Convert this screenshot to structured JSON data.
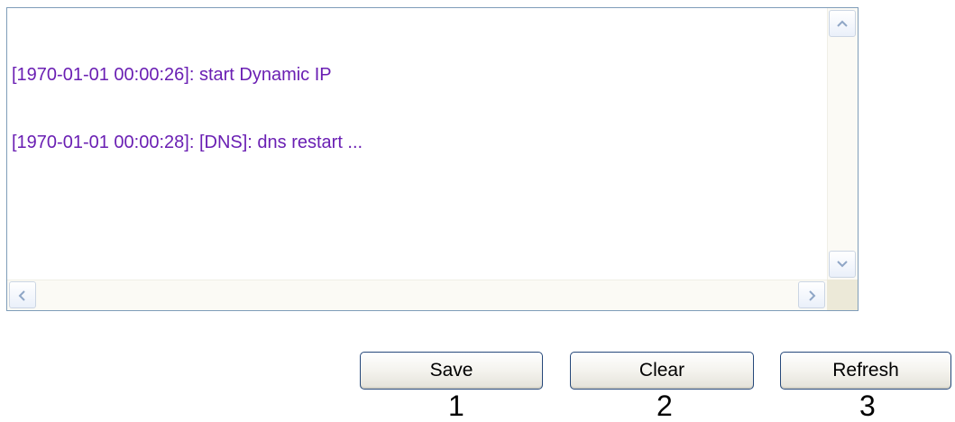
{
  "log": {
    "lines": [
      "[1970-01-01 00:00:26]: start Dynamic IP",
      "[1970-01-01 00:00:28]: [DNS]: dns restart ..."
    ]
  },
  "buttons": {
    "save_label": "Save",
    "clear_label": "Clear",
    "refresh_label": "Refresh"
  },
  "annotations": [
    "1",
    "2",
    "3"
  ],
  "colors": {
    "log_text": "#6a1fb3",
    "button_border": "#26487a",
    "box_border": "#7f9db9"
  },
  "icons": {
    "scroll_up": "chevron-up-icon",
    "scroll_down": "chevron-down-icon",
    "scroll_left": "chevron-left-icon",
    "scroll_right": "chevron-right-icon"
  }
}
